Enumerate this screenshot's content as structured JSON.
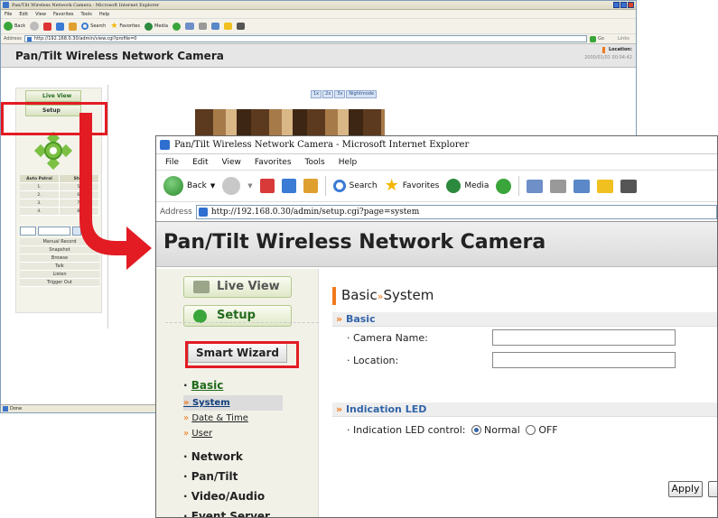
{
  "back_window": {
    "title": "Pan/Tilt Wireless Network Camera - Microsoft Internet Explorer",
    "menu": [
      "File",
      "Edit",
      "View",
      "Favorites",
      "Tools",
      "Help"
    ],
    "toolbar": {
      "back": "Back",
      "search": "Search",
      "favorites": "Favorites",
      "media": "Media"
    },
    "address_label": "Address",
    "address": "http://192.168.0.30/admin/view.cgi?profile=0",
    "go": "Go",
    "links": "Links",
    "header_title": "Pan/Tilt Wireless Network Camera",
    "location_label": "Location:",
    "datetime": "2000/01/01 00:04:42",
    "live_view": "Live View",
    "setup": "Setup",
    "zoom": [
      "1x",
      "2x",
      "3x",
      "Nightmode"
    ],
    "patrol_header": [
      "Auto Patrol",
      "Stop"
    ],
    "patrol_rows": [
      [
        "1.",
        "5."
      ],
      [
        "2.",
        "6."
      ],
      [
        "3.",
        "7."
      ],
      [
        "4.",
        "8."
      ]
    ],
    "ops": [
      "Manual Record",
      "Snapshot",
      "Browse",
      "Talk",
      "Listen",
      "Trigger Out"
    ],
    "status": "Done"
  },
  "front_window": {
    "title": "Pan/Tilt Wireless Network Camera - Microsoft Internet Explorer",
    "menu": [
      "File",
      "Edit",
      "View",
      "Favorites",
      "Tools",
      "Help"
    ],
    "toolbar": {
      "back": "Back",
      "search": "Search",
      "favorites": "Favorites",
      "media": "Media"
    },
    "address_label": "Address",
    "address": "http://192.168.0.30/admin/setup.cgi?page=system",
    "header_title": "Pan/Tilt Wireless Network Camera",
    "live_view": "Live View",
    "setup": "Setup",
    "smart_wizard": "Smart Wizard",
    "menu_items": {
      "basic": "Basic",
      "system": "System",
      "date_time": "Date & Time",
      "user": "User",
      "network": "Network",
      "pan_tilt": "Pan/Tilt",
      "video_audio": "Video/Audio",
      "event_server": "Event Server"
    },
    "page_heading_a": "Basic",
    "page_heading_sep": "»",
    "page_heading_b": "System",
    "sections": {
      "basic": "Basic",
      "indication_led": "Indication LED"
    },
    "fields": {
      "camera_name_label": "Camera Name:",
      "camera_name_value": "",
      "location_label": "Location:",
      "location_value": "",
      "led_control_label": "Indication LED control:",
      "led_normal": "Normal",
      "led_off": "OFF",
      "led_selected": "Normal"
    },
    "apply": "Apply"
  },
  "colors": {
    "highlight_red": "#e31b23",
    "accent_orange": "#f07a1c",
    "section_blue": "#3264a8",
    "nav_green": "#246b1e"
  }
}
